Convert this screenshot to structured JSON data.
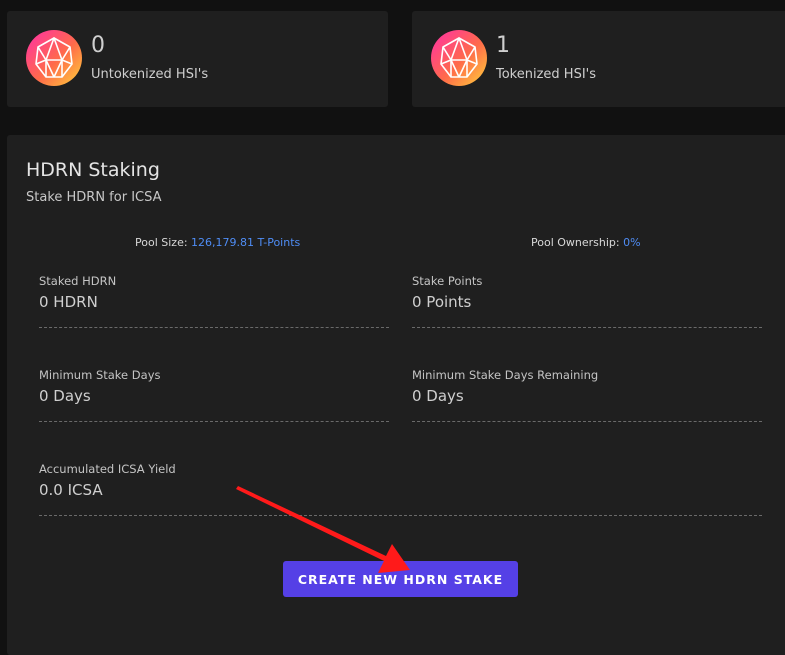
{
  "stats": [
    {
      "value": "0",
      "label": "Untokenized HSI's",
      "icon": "hedron-logo-icon"
    },
    {
      "value": "1",
      "label": "Tokenized HSI's",
      "icon": "hedron-logo-icon"
    }
  ],
  "staking": {
    "title": "HDRN Staking",
    "subtitle": "Stake HDRN for ICSA",
    "pool_size_label": "Pool Size:",
    "pool_size_value": "126,179.81 T-Points",
    "pool_ownership_label": "Pool Ownership:",
    "pool_ownership_value": "0%",
    "fields": {
      "staked_hdrn": {
        "label": "Staked HDRN",
        "value": "0 HDRN"
      },
      "stake_points": {
        "label": "Stake Points",
        "value": "0 Points"
      },
      "min_stake_days": {
        "label": "Minimum Stake Days",
        "value": "0 Days"
      },
      "min_stake_days_remaining": {
        "label": "Minimum Stake Days Remaining",
        "value": "0 Days"
      },
      "accumulated_yield": {
        "label": "Accumulated ICSA Yield",
        "value": "0.0 ICSA"
      }
    },
    "create_button_label": "CREATE NEW HDRN STAKE"
  },
  "annotation": {
    "arrow": "red-arrow-icon",
    "color": "#ff1a1a"
  },
  "colors": {
    "accent": "#5540e6",
    "link": "#4f8df5",
    "panel": "#1f1f1f",
    "background": "#111111"
  }
}
